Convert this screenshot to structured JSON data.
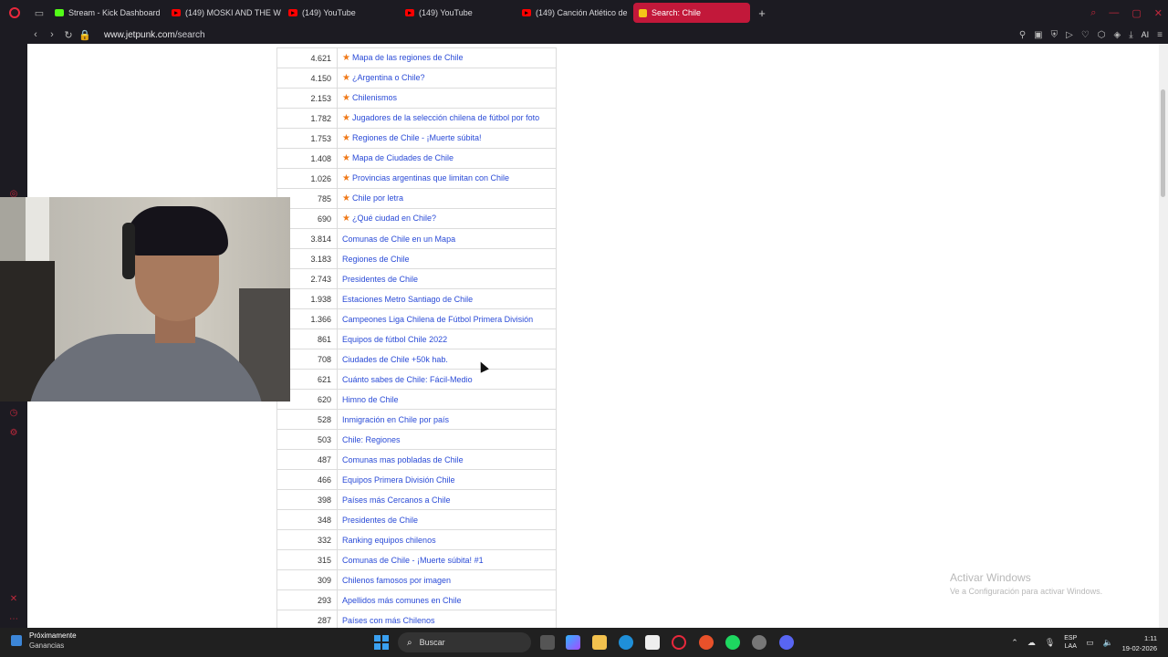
{
  "browser": {
    "tabs": [
      {
        "label": "Stream - Kick Dashboard",
        "icon": "kick-icon",
        "active": false
      },
      {
        "label": "(149) MOSKI AND THE W",
        "icon": "youtube-icon",
        "active": false
      },
      {
        "label": "(149) YouTube",
        "icon": "youtube-icon",
        "active": false
      },
      {
        "label": "(149) YouTube",
        "icon": "youtube-icon",
        "active": false
      },
      {
        "label": "(149) Canción Atlético de",
        "icon": "youtube-icon",
        "active": false
      },
      {
        "label": "Search: Chile",
        "icon": "jetpunk-icon",
        "active": true
      }
    ],
    "new_tab_glyph": "+",
    "url_host": "www.jetpunk.com",
    "url_path": "/search",
    "ai_label": "AI"
  },
  "results": [
    {
      "count": "4.621",
      "title": "Mapa de las regiones de Chile",
      "starred": true
    },
    {
      "count": "4.150",
      "title": "¿Argentina o Chile?",
      "starred": true
    },
    {
      "count": "2.153",
      "title": "Chilenismos",
      "starred": true
    },
    {
      "count": "1.782",
      "title": "Jugadores de la selección chilena de fútbol por foto",
      "starred": true
    },
    {
      "count": "1.753",
      "title": "Regiones de Chile - ¡Muerte súbita!",
      "starred": true
    },
    {
      "count": "1.408",
      "title": "Mapa de Ciudades de Chile",
      "starred": true
    },
    {
      "count": "1.026",
      "title": "Provincias argentinas que limitan con Chile",
      "starred": true
    },
    {
      "count": "785",
      "title": "Chile por letra",
      "starred": true
    },
    {
      "count": "690",
      "title": "¿Qué ciudad en Chile?",
      "starred": true
    },
    {
      "count": "3.814",
      "title": "Comunas de Chile en un Mapa",
      "starred": false
    },
    {
      "count": "3.183",
      "title": "Regiones de Chile",
      "starred": false
    },
    {
      "count": "2.743",
      "title": "Presidentes de Chile",
      "starred": false
    },
    {
      "count": "1.938",
      "title": "Estaciones Metro Santiago de Chile",
      "starred": false
    },
    {
      "count": "1.366",
      "title": "Campeones Liga Chilena de Fútbol Primera División",
      "starred": false
    },
    {
      "count": "861",
      "title": "Equipos de fútbol Chile 2022",
      "starred": false
    },
    {
      "count": "708",
      "title": "Ciudades de Chile +50k hab.",
      "starred": false
    },
    {
      "count": "621",
      "title": "Cuánto sabes de Chile: Fácil-Medio",
      "starred": false
    },
    {
      "count": "620",
      "title": "Himno de Chile",
      "starred": false
    },
    {
      "count": "528",
      "title": "Inmigración en Chile por país",
      "starred": false
    },
    {
      "count": "503",
      "title": "Chile: Regiones",
      "starred": false
    },
    {
      "count": "487",
      "title": "Comunas mas pobladas de Chile",
      "starred": false
    },
    {
      "count": "466",
      "title": "Equipos Primera División Chile",
      "starred": false
    },
    {
      "count": "398",
      "title": "Países más Cercanos a Chile",
      "starred": false
    },
    {
      "count": "348",
      "title": "Presidentes de Chile",
      "starred": false
    },
    {
      "count": "332",
      "title": "Ranking equipos chilenos",
      "starred": false
    },
    {
      "count": "315",
      "title": "Comunas de Chile - ¡Muerte súbita! #1",
      "starred": false
    },
    {
      "count": "309",
      "title": "Chilenos famosos por imagen",
      "starred": false
    },
    {
      "count": "293",
      "title": "Apellidos más comunes en Chile",
      "starred": false
    },
    {
      "count": "287",
      "title": "Países con más Chilenos",
      "starred": false
    }
  ],
  "star_glyph": "★",
  "watermark": {
    "title": "Activar Windows",
    "subtitle": "Ve a Configuración para activar Windows."
  },
  "taskbar": {
    "widget_title": "Próximamente",
    "widget_subtitle": "Ganancias",
    "search_placeholder": "Buscar",
    "lang_top": "ESP",
    "lang_bottom": "LAA",
    "time": "1:11",
    "date": "19-02-2026"
  },
  "colors": {
    "accent": "#c2183a",
    "link": "#2a4bd7",
    "star": "#f07a1a"
  }
}
